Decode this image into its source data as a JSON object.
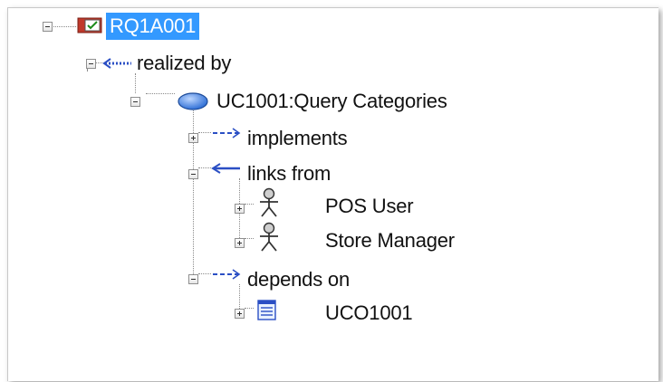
{
  "tree": {
    "root": {
      "label": "RQ1A001",
      "icon": "requirement-icon",
      "selected": true
    },
    "realized_by": {
      "label": "realized by",
      "icon": "realization-arrow-icon"
    },
    "use_case": {
      "label": "UC1001:Query Categories",
      "icon": "use-case-icon"
    },
    "implements": {
      "label": "implements",
      "icon": "dashed-arrow-icon"
    },
    "links_from": {
      "label": "links from",
      "icon": "link-arrow-icon"
    },
    "pos_user": {
      "label": "POS User",
      "icon": "actor-icon"
    },
    "store_manager": {
      "label": "Store Manager",
      "icon": "actor-icon"
    },
    "depends_on": {
      "label": "depends on",
      "icon": "dashed-arrow-icon"
    },
    "uco1001": {
      "label": "UCO1001",
      "icon": "document-icon"
    }
  },
  "colors": {
    "selection": "#3399ff",
    "use_case_blue": "#3a7bd5",
    "arrow_blue": "#2b4fc4"
  }
}
